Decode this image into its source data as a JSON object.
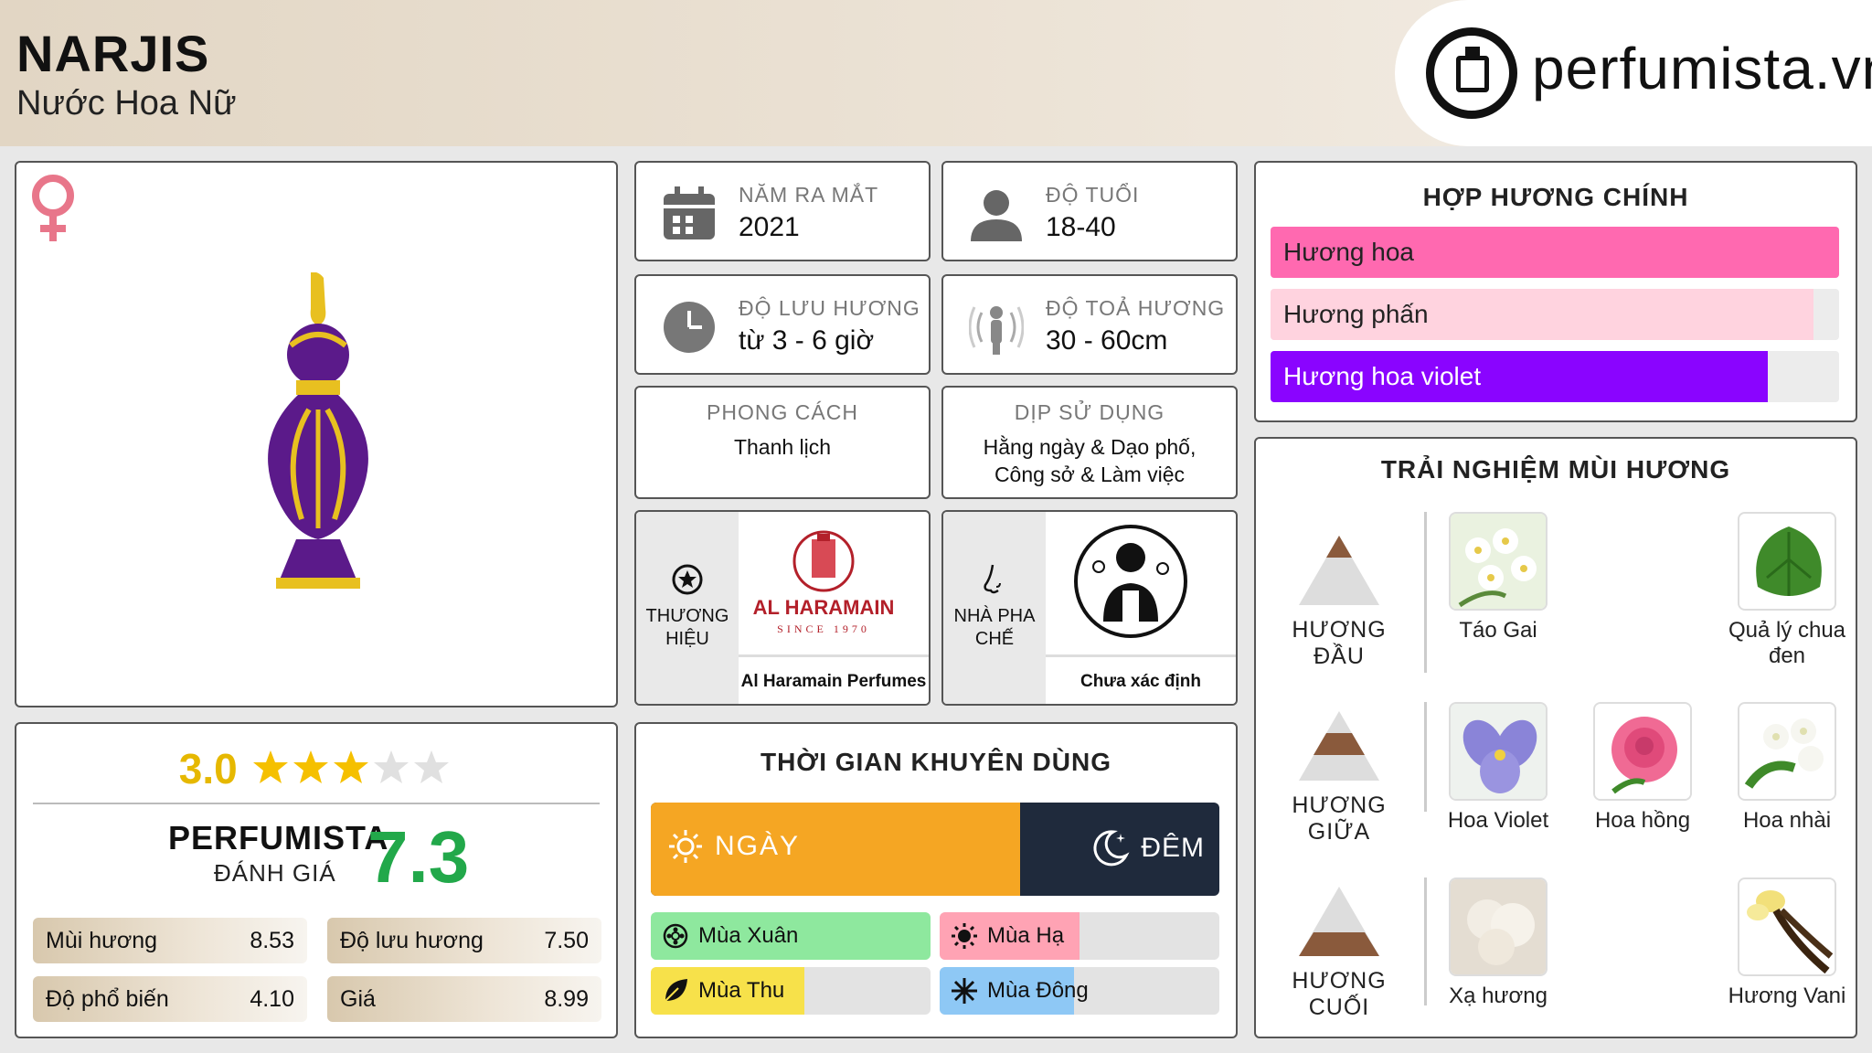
{
  "header": {
    "title": "NARJIS",
    "subtitle": "Nước Hoa Nữ",
    "logo_text": "perfumista.vn"
  },
  "rating": {
    "score": "3.0",
    "stars": 3,
    "max_stars": 5,
    "pf_label": "PERFUMISTA",
    "pf_sub": "ĐÁNH GIÁ",
    "pf_score": "7.3",
    "metrics": [
      {
        "label": "Mùi hương",
        "value": "8.53"
      },
      {
        "label": "Độ lưu hương",
        "value": "7.50"
      },
      {
        "label": "Độ phổ biến",
        "value": "4.10"
      },
      {
        "label": "Giá",
        "value": "8.99"
      }
    ]
  },
  "info": {
    "launch": {
      "label": "NĂM RA MẮT",
      "value": "2021"
    },
    "age": {
      "label": "ĐỘ TUỔI",
      "value": "18-40"
    },
    "longevity": {
      "label": "ĐỘ LƯU HƯƠNG",
      "value": "từ 3 - 6 giờ"
    },
    "sillage": {
      "label": "ĐỘ TOẢ HƯƠNG",
      "value": "30 - 60cm"
    },
    "style": {
      "label": "PHONG CÁCH",
      "value": "Thanh lịch"
    },
    "occasion": {
      "label": "DỊP SỬ DỤNG",
      "value": "Hằng ngày & Dạo phố, Công sở & Làm việc"
    },
    "brand": {
      "label": "THƯƠNG HIỆU",
      "name": "Al Haramain Perfumes",
      "logo_main": "AL HARAMAIN",
      "logo_sub": "SINCE 1970"
    },
    "perfumer": {
      "label": "NHÀ PHA CHẾ",
      "name": "Chưa xác định"
    }
  },
  "usage": {
    "title": "THỜI GIAN KHUYÊN DÙNG",
    "day_label": "NGÀY",
    "night_label": "ĐÊM",
    "day_fraction": 0.65,
    "seasons": [
      {
        "label": "Mùa Xuân",
        "fraction": 1.0,
        "color": "#8ee89e"
      },
      {
        "label": "Mùa Hạ",
        "fraction": 0.5,
        "color": "#ffa3b4"
      },
      {
        "label": "Mùa Thu",
        "fraction": 0.55,
        "color": "#f7e14a"
      },
      {
        "label": "Mùa Đông",
        "fraction": 0.48,
        "color": "#8ec8f5"
      }
    ]
  },
  "accords": {
    "title": "HỢP HƯƠNG CHÍNH",
    "items": [
      {
        "label": "Hương hoa",
        "fraction": 1.0,
        "color": "#ff69b0",
        "text_color": "#222"
      },
      {
        "label": "Hương phấn",
        "fraction": 0.955,
        "color": "#ffd3df",
        "text_color": "#222"
      },
      {
        "label": "Hương hoa violet",
        "fraction": 0.875,
        "color": "#8a04ff",
        "text_color": "#ffffff"
      }
    ]
  },
  "notes": {
    "title": "TRẢI NGHIỆM MÙI HƯƠNG",
    "top": {
      "label": "HƯƠNG ĐẦU",
      "items": [
        "Táo Gai",
        "Quả lý chua đen"
      ]
    },
    "middle": {
      "label": "HƯƠNG GIỮA",
      "items": [
        "Hoa Violet",
        "Hoa hồng",
        "Hoa nhài"
      ]
    },
    "base": {
      "label": "HƯƠNG CUỐI",
      "items": [
        "Xạ hương",
        "Hương Vani"
      ]
    }
  }
}
